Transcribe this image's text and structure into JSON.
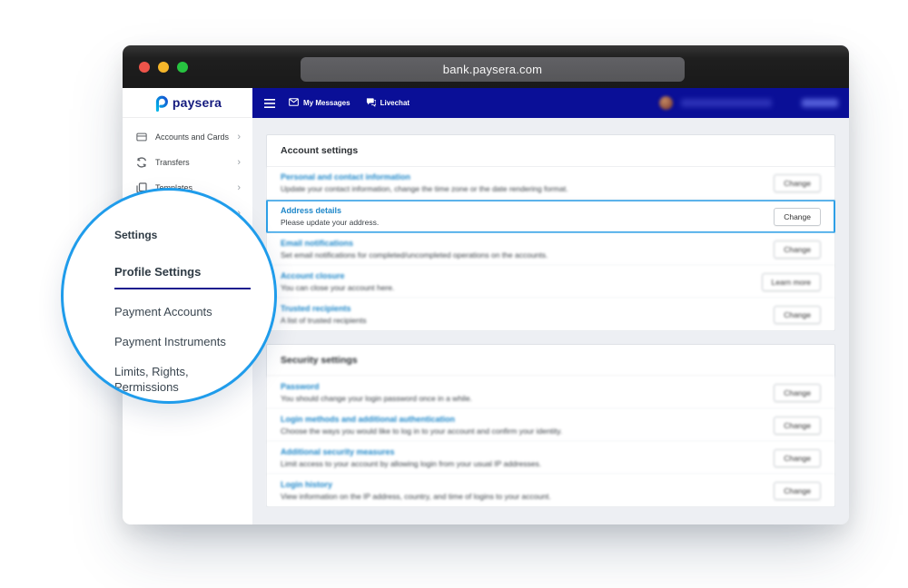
{
  "browser": {
    "url": "bank.paysera.com"
  },
  "brand": {
    "logo_icon": "paysera-p-icon",
    "wordmark": "paysera"
  },
  "topnav": {
    "menu_icon": "hamburger-icon",
    "items": [
      {
        "icon": "envelope-icon",
        "label": "My Messages"
      },
      {
        "icon": "chat-icon",
        "label": "Livechat"
      }
    ]
  },
  "sidebar": {
    "items": [
      {
        "icon": "card-icon",
        "label": "Accounts and Cards",
        "chevron": "›"
      },
      {
        "icon": "transfer-icon",
        "label": "Transfers",
        "chevron": "›"
      },
      {
        "icon": "templates-icon",
        "label": "Templates",
        "chevron": "›"
      },
      {
        "icon": "",
        "label": "",
        "chevron": "›"
      }
    ]
  },
  "magnifier": {
    "section_title": "Settings",
    "active_item": "Profile Settings",
    "items": [
      "Payment Accounts",
      "Payment Instruments",
      "Limits, Rights, Permissions"
    ]
  },
  "account_settings": {
    "title": "Account settings",
    "rows": [
      {
        "title": "Personal and contact information",
        "desc": "Update your contact information, change the time zone or the date rendering format.",
        "button": "Change",
        "blurred": true
      },
      {
        "title": "Address details",
        "desc": "Please update your address.",
        "button": "Change",
        "highlighted": true
      },
      {
        "title": "Email notifications",
        "desc": "Set email notifications for completed/uncompleted operations on the accounts.",
        "button": "Change",
        "blurred": true
      },
      {
        "title": "Account closure",
        "desc": "You can close your account here.",
        "button": "Learn more",
        "blurred": true
      },
      {
        "title": "Trusted recipients",
        "desc": "A list of trusted recipients",
        "button": "Change",
        "blurred": true
      }
    ]
  },
  "security_settings": {
    "title": "Security settings",
    "rows": [
      {
        "title": "Password",
        "desc": "You should change your login password once in a while.",
        "button": "Change",
        "blurred": true
      },
      {
        "title": "Login methods and additional authentication",
        "desc": "Choose the ways you would like to log in to your account and confirm your identity.",
        "button": "Change",
        "blurred": true
      },
      {
        "title": "Additional security measures",
        "desc": "Limit access to your account by allowing login from your usual IP addresses.",
        "button": "Change",
        "blurred": true
      },
      {
        "title": "Login history",
        "desc": "View information on the IP address, country, and time of logins to your account.",
        "button": "Change",
        "blurred": true
      }
    ]
  },
  "colors": {
    "navbar_blue": "#0a0f97",
    "magnifier_accent": "#1f9ceb",
    "link_blue": "#1e87c9",
    "active_underline_navy": "#1d1d8e",
    "highlight_border": "#2d9fe6"
  }
}
